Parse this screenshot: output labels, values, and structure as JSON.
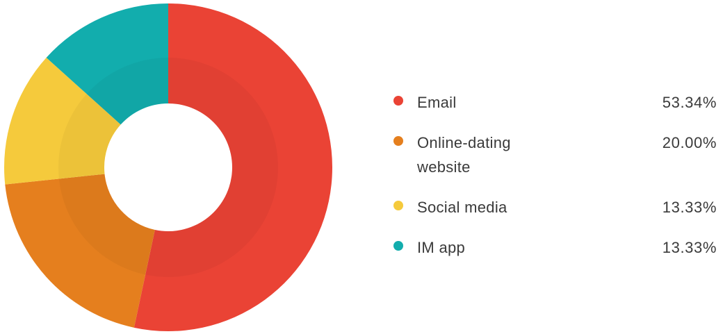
{
  "chart_data": {
    "type": "pie",
    "style": "donut",
    "title": "",
    "legend_position": "right",
    "slices": [
      {
        "label": "Email",
        "value": 53.34,
        "value_label": "53.34%",
        "color": "#ea4335"
      },
      {
        "label": "Online-dating website",
        "value": 20.0,
        "value_label": "20.00%",
        "color": "#e57f1e"
      },
      {
        "label": "Social media",
        "value": 13.33,
        "value_label": "13.33%",
        "color": "#f5ca3c"
      },
      {
        "label": "IM app",
        "value": 13.33,
        "value_label": "13.33%",
        "color": "#12adad"
      }
    ]
  }
}
